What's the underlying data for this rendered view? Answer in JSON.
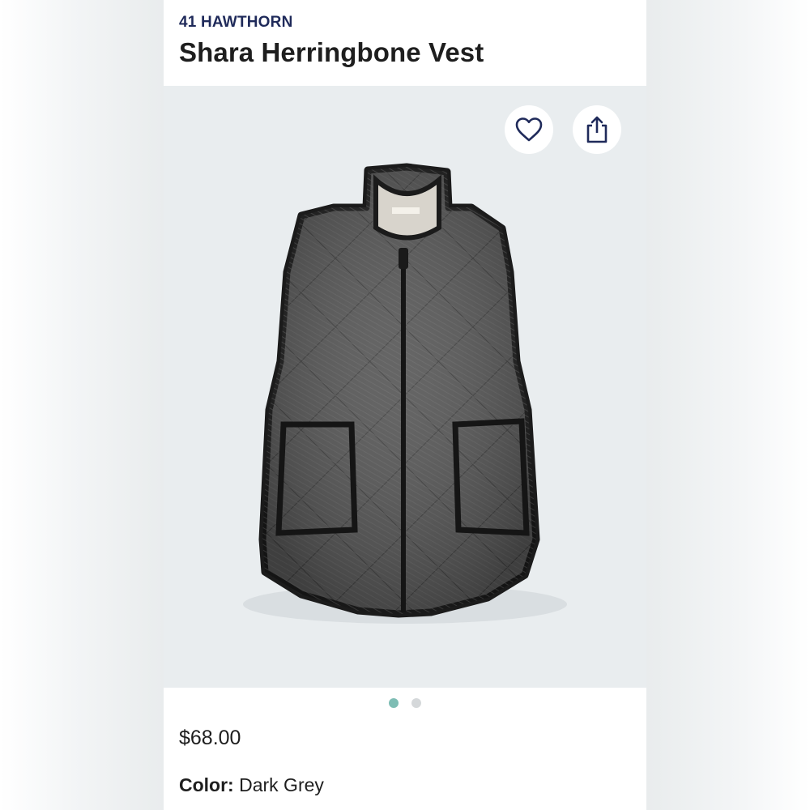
{
  "product": {
    "brand": "41 HAWTHORN",
    "name": "Shara Herringbone Vest",
    "price": "$68.00",
    "color_label": "Color:",
    "color_value": "Dark Grey"
  },
  "gallery": {
    "image_count": 2,
    "active_index": 0,
    "active_dot_color": "#7ebdb4",
    "inactive_dot_color": "#d5d8da",
    "background": "#e9edef"
  },
  "actions": {
    "favorite_icon": "heart-outline-icon",
    "share_icon": "share-upload-icon"
  },
  "theme": {
    "brand_color": "#1f2a5a",
    "text_color": "#1e1e1e"
  }
}
